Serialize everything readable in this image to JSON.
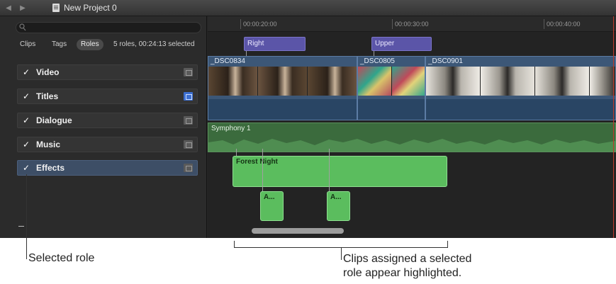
{
  "window": {
    "title": "New Project 0"
  },
  "index": {
    "tabs": [
      "Clips",
      "Tags",
      "Roles"
    ],
    "summary": "5 roles, 00:24:13 selected",
    "roles": [
      {
        "label": "Video",
        "checked": true,
        "selected": false,
        "lane_highlighted": false
      },
      {
        "label": "Titles",
        "checked": true,
        "selected": false,
        "lane_highlighted": true
      },
      {
        "label": "Dialogue",
        "checked": true,
        "selected": false,
        "lane_highlighted": false
      },
      {
        "label": "Music",
        "checked": true,
        "selected": false,
        "lane_highlighted": false
      },
      {
        "label": "Effects",
        "checked": true,
        "selected": true,
        "lane_highlighted": false
      }
    ]
  },
  "timeline": {
    "ruler": [
      "00:00:20:00",
      "00:00:30:00",
      "00:00:40:00"
    ],
    "title_clips": [
      "Right",
      "Upper"
    ],
    "video_clips": [
      "_DSC0834",
      "_DSC0805",
      "_DSC0901"
    ],
    "music_clip": "Symphony 1",
    "effects_clip": "Forest Night",
    "small_effects": [
      "A...",
      "A..."
    ]
  },
  "callouts": {
    "selected_role": "Selected role",
    "clips_line1": "Clips assigned a selected",
    "clips_line2": "role appear highlighted."
  },
  "colors": {
    "title_role": "#5b55a8",
    "video_role": "#3c5777",
    "music_role": "#3b6b3d",
    "effects_highlight": "#5bbd5e",
    "selected_role_bg": "#3d4e66",
    "playhead": "#c03a2b"
  }
}
